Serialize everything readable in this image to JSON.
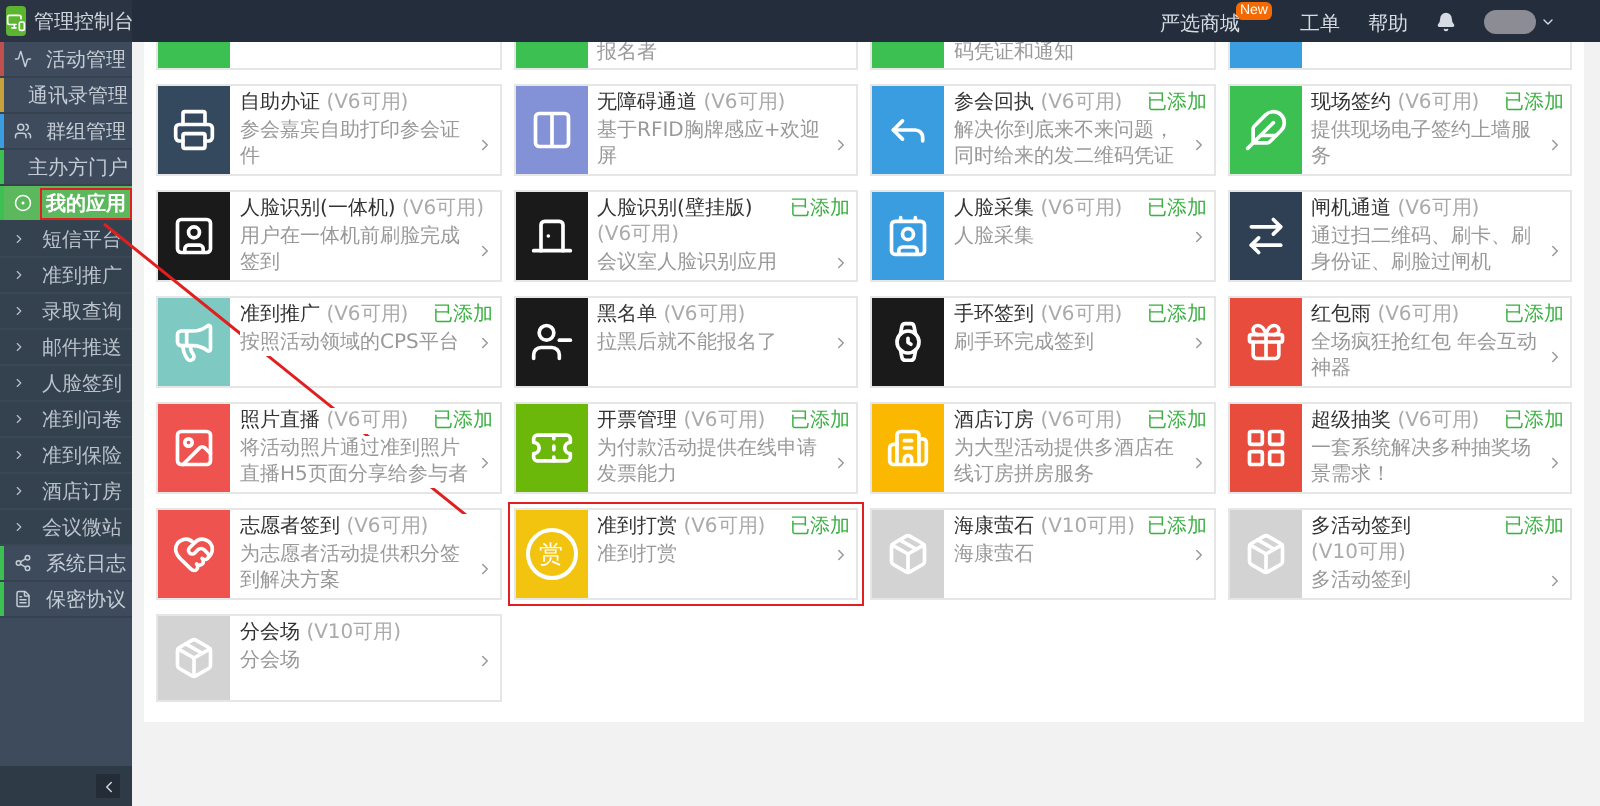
{
  "header": {
    "title": "管理控制台",
    "links": [
      {
        "label": "严选商城",
        "badge": "New"
      },
      {
        "label": "工单"
      },
      {
        "label": "帮助"
      }
    ]
  },
  "sidebar": {
    "items": [
      {
        "label": "活动管理",
        "color": "#c0504d",
        "selected": false,
        "annotated": false
      },
      {
        "label": "通讯录管理",
        "color": "#c9a13b",
        "selected": false,
        "annotated": false
      },
      {
        "label": "群组管理",
        "color": "#3a9de0",
        "selected": false,
        "annotated": false
      },
      {
        "label": "主办方门户",
        "color": "#3cc051",
        "selected": false,
        "annotated": false
      },
      {
        "label": "我的应用",
        "color": "#3cc051",
        "selected": true,
        "annotated": true,
        "expanded": true,
        "children": [
          {
            "label": "短信平台",
            "selected": false
          },
          {
            "label": "准到推广",
            "selected": false
          },
          {
            "label": "录取查询",
            "selected": false
          },
          {
            "label": "邮件推送",
            "selected": false
          },
          {
            "label": "人脸签到",
            "selected": false
          },
          {
            "label": "准到问卷",
            "selected": false
          },
          {
            "label": "准到保险",
            "selected": false
          },
          {
            "label": "酒店订房",
            "selected": false
          },
          {
            "label": "会议微站",
            "selected": false
          }
        ]
      },
      {
        "label": "系统日志",
        "color": "#3cc051",
        "selected": false,
        "annotated": false
      },
      {
        "label": "保密协议",
        "color": "#3cc051",
        "selected": false,
        "annotated": false
      }
    ]
  },
  "cards": [
    {
      "kind": "partial",
      "color": "#3cc051"
    },
    {
      "kind": "partial",
      "color": "#3cc051",
      "desc": "报名者"
    },
    {
      "kind": "partial",
      "color": "#3cc051",
      "desc": "码凭证和通知"
    },
    {
      "kind": "partial",
      "color": "#3a9de0"
    },
    {
      "kind": "full",
      "title": "自助办证",
      "version": "(V6可用)",
      "desc": "参会嘉宾自助打印参会证件",
      "color": "#34495e"
    },
    {
      "kind": "full",
      "title": "无障碍通道",
      "version": "(V6可用)",
      "desc": "基于RFID胸牌感应+欢迎屏",
      "color": "#8391d6"
    },
    {
      "kind": "full",
      "title": "参会回执",
      "version": "(V6可用)",
      "status": "已添加",
      "desc": "解决你到底来不来问题，同时给来的发二维码凭证",
      "color": "#3a9de0"
    },
    {
      "kind": "full",
      "title": "现场签约",
      "version": "(V6可用)",
      "status": "已添加",
      "desc": "提供现场电子签约上墙服务",
      "color": "#3cc051"
    },
    {
      "kind": "full",
      "title": "人脸识别(一体机)",
      "version": "(V6可用)",
      "desc": "用户在一体机前刷脸完成签到",
      "color": "#1a1a1a"
    },
    {
      "kind": "full",
      "title": "人脸识别(壁挂版)",
      "version": "(V6可用)",
      "status": "已添加",
      "desc": "会议室人脸识别应用",
      "color": "#1a1a1a"
    },
    {
      "kind": "full",
      "title": "人脸采集",
      "version": "(V6可用)",
      "status": "已添加",
      "desc": "人脸采集",
      "color": "#3a9de0"
    },
    {
      "kind": "full",
      "title": "闸机通道",
      "version": "(V6可用)",
      "desc": "通过扫二维码、刷卡、刷身份证、刷脸过闸机",
      "color": "#2f4054"
    },
    {
      "kind": "full",
      "title": "准到推广",
      "version": "(V6可用)",
      "status": "已添加",
      "desc": "按照活动领域的CPS平台",
      "color": "#7ecac3"
    },
    {
      "kind": "full",
      "title": "黑名单",
      "version": "(V6可用)",
      "desc": "拉黑后就不能报名了",
      "color": "#1a1a1a"
    },
    {
      "kind": "full",
      "title": "手环签到",
      "version": "(V6可用)",
      "status": "已添加",
      "desc": "刷手环完成签到",
      "color": "#1a1a1a"
    },
    {
      "kind": "full",
      "title": "红包雨",
      "version": "(V6可用)",
      "status": "已添加",
      "desc": "全场疯狂抢红包 年会互动神器",
      "color": "#e74c3c"
    },
    {
      "kind": "full",
      "title": "照片直播",
      "version": "(V6可用)",
      "status": "已添加",
      "desc": "将活动照片通过准到照片直播H5页面分享给参与者",
      "color": "#ef5350"
    },
    {
      "kind": "full",
      "title": "开票管理",
      "version": "(V6可用)",
      "status": "已添加",
      "desc": "为付款活动提供在线申请发票能力",
      "color": "#6bb70a"
    },
    {
      "kind": "full",
      "title": "酒店订房",
      "version": "(V6可用)",
      "status": "已添加",
      "desc": "为大型活动提供多酒店在线订房拼房服务",
      "color": "#fbb800"
    },
    {
      "kind": "full",
      "title": "超级抽奖",
      "version": "(V6可用)",
      "status": "已添加",
      "desc": "一套系统解决多种抽奖场景需求！",
      "color": "#e74c3c"
    },
    {
      "kind": "full",
      "title": "志愿者签到",
      "version": "(V6可用)",
      "desc": "为志愿者活动提供积分签到解决方案",
      "color": "#ef5350"
    },
    {
      "kind": "full",
      "title": "准到打赏",
      "version": "(V6可用)",
      "status": "已添加",
      "annotated": true,
      "desc": "准到打赏",
      "color": "#f2c40f",
      "glyph": "赏"
    },
    {
      "kind": "full",
      "title": "海康萤石",
      "version": "(V10可用)",
      "status": "已添加",
      "desc": "海康萤石",
      "color": "#d3d3d3"
    },
    {
      "kind": "full",
      "title": "多活动签到",
      "version": "(V10可用)",
      "status": "已添加",
      "desc": "多活动签到",
      "color": "#d3d3d3"
    },
    {
      "kind": "full",
      "title": "分会场",
      "version": "(V10可用)",
      "desc": "分会场",
      "color": "#d3d3d3"
    }
  ]
}
